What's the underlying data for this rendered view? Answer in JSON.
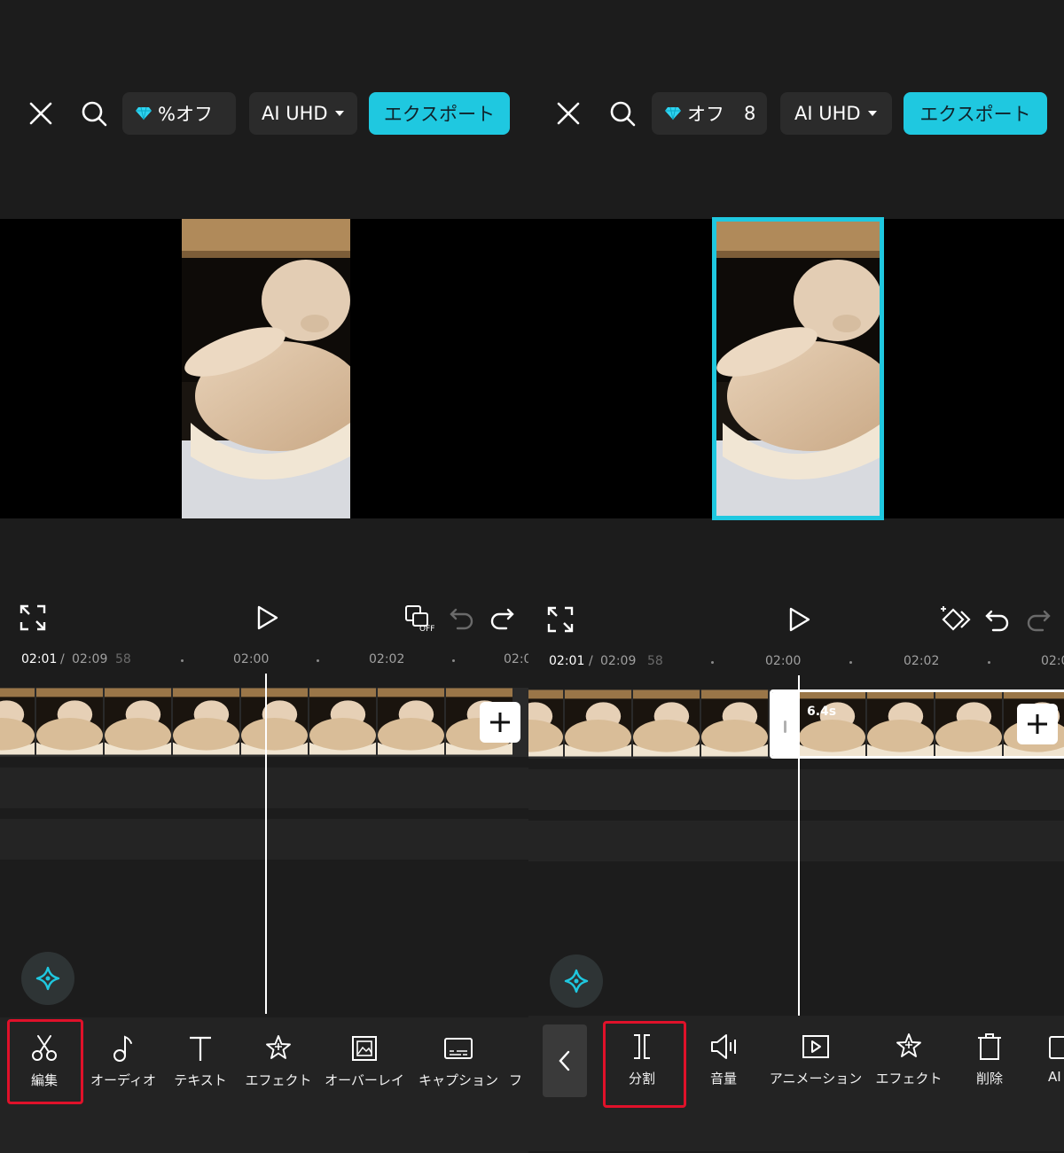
{
  "colors": {
    "accent": "#1fc8e0",
    "highlight": "#e0112a",
    "background": "#1c1c1c"
  },
  "left": {
    "topbar": {
      "close_icon": "close-icon",
      "search_icon": "search-icon",
      "promo_label": "%オフ",
      "quality_label": "AI UHD",
      "export_label": "エクスポート"
    },
    "timeline": {
      "current_time": "02:01",
      "separator": "/",
      "total_time": "02:09",
      "trailing_fragment": "58",
      "ticks": [
        "02:00",
        "02:02",
        "02:0"
      ]
    },
    "toolbar": {
      "items": [
        {
          "label": "編集",
          "icon": "scissors-icon"
        },
        {
          "label": "オーディオ",
          "icon": "music-note-icon"
        },
        {
          "label": "テキスト",
          "icon": "text-icon"
        },
        {
          "label": "エフェクト",
          "icon": "sparkle-star-icon"
        },
        {
          "label": "オーバーレイ",
          "icon": "overlay-image-icon"
        },
        {
          "label": "キャプション",
          "icon": "caption-icon"
        },
        {
          "label": "フ",
          "icon": "filter-icon"
        }
      ],
      "highlighted": "編集"
    }
  },
  "right": {
    "topbar": {
      "close_icon": "close-icon",
      "search_icon": "search-icon",
      "promo_label": "オフ",
      "promo_trailing": "8",
      "quality_label": "AI UHD",
      "export_label": "エクスポート"
    },
    "timeline": {
      "current_time": "02:01",
      "separator": "/",
      "total_time": "02:09",
      "trailing_fragment": "58",
      "ticks": [
        "02:00",
        "02:02",
        "02:0"
      ],
      "clip_duration": "6.4s"
    },
    "toolbar": {
      "items": [
        {
          "label": "分割",
          "icon": "split-icon"
        },
        {
          "label": "音量",
          "icon": "volume-icon"
        },
        {
          "label": "アニメーション",
          "icon": "animation-play-icon"
        },
        {
          "label": "エフェクト",
          "icon": "sparkle-star-icon"
        },
        {
          "label": "削除",
          "icon": "trash-icon"
        },
        {
          "label": "AI",
          "icon": "ai-icon"
        }
      ],
      "highlighted": "分割"
    }
  }
}
